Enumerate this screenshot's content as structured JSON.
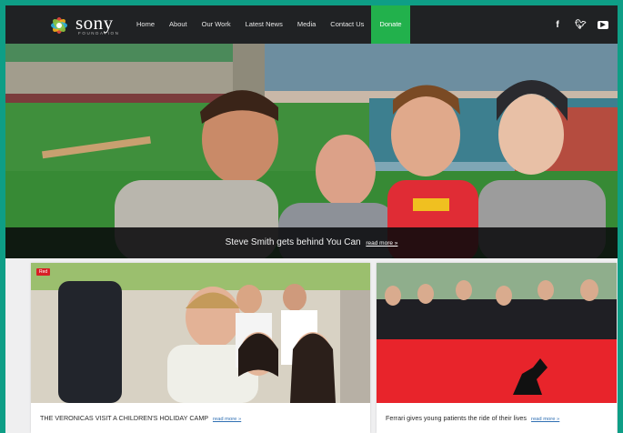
{
  "brand": {
    "name": "sony",
    "tagline": "FOUNDATION"
  },
  "nav": {
    "items": [
      "Home",
      "About",
      "Our Work",
      "Latest News",
      "Media",
      "Contact Us",
      "Donate"
    ],
    "active_index": 6
  },
  "social": [
    "facebook-icon",
    "twitter-icon",
    "youtube-icon"
  ],
  "hero": {
    "caption": "Steve Smith gets behind You Can",
    "read_more": "read more »"
  },
  "cards": [
    {
      "caption": "THE VERONICAS VISIT A CHILDREN'S HOLIDAY CAMP",
      "read_more": "read more »"
    },
    {
      "caption": "Ferrari gives young patients the ride of their lives",
      "read_more": "read more »"
    }
  ],
  "colors": {
    "accent": "#22b14c",
    "nav_bg": "#202224",
    "border": "#0e9e86",
    "flag_red": "#e8242b"
  }
}
